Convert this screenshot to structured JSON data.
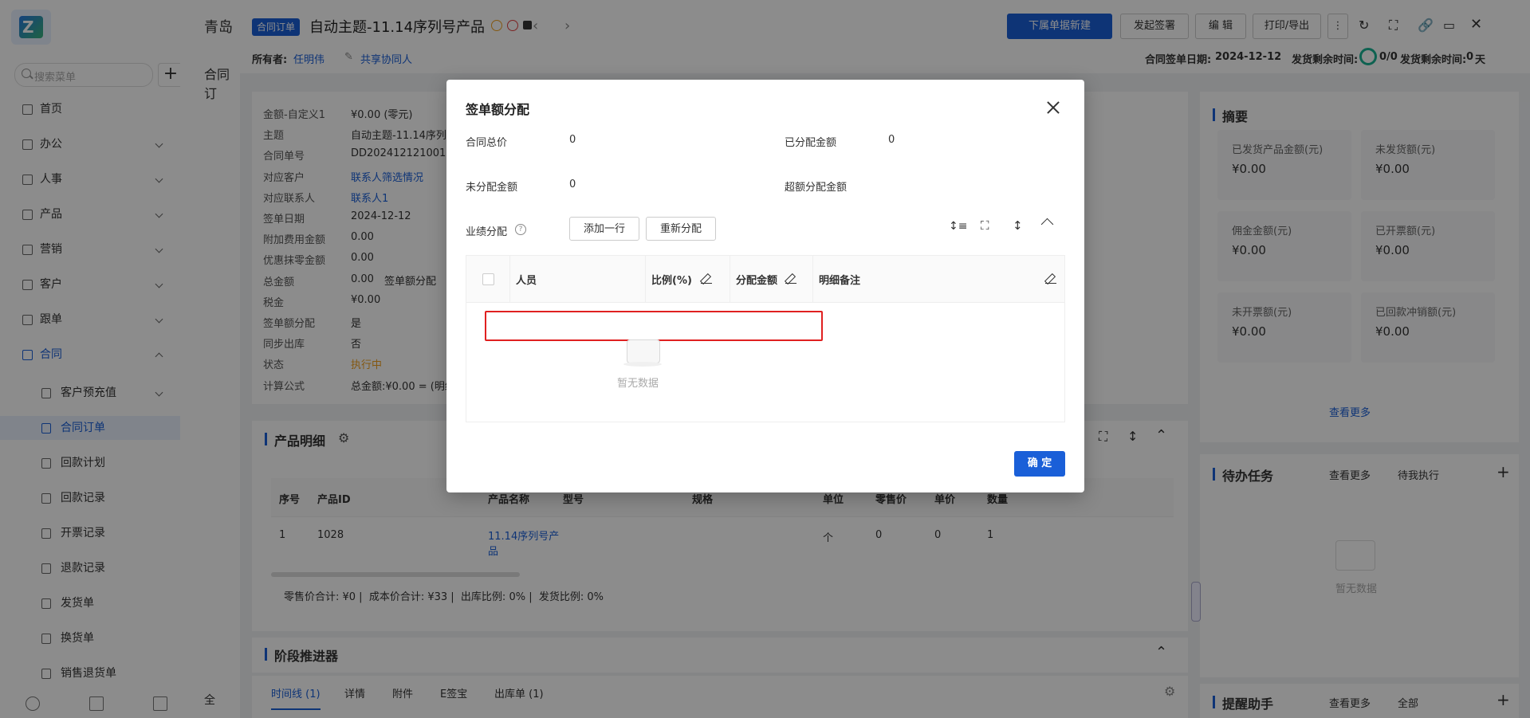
{
  "sidebar": {
    "search_placeholder": "搜索菜单",
    "add_label": "+",
    "items": [
      {
        "label": "首页",
        "icon": "home-icon"
      },
      {
        "label": "办公",
        "icon": "office-icon"
      },
      {
        "label": "人事",
        "icon": "people-icon"
      },
      {
        "label": "产品",
        "icon": "product-icon"
      },
      {
        "label": "营销",
        "icon": "marketing-icon"
      },
      {
        "label": "客户",
        "icon": "customer-icon"
      },
      {
        "label": "跟单",
        "icon": "followup-icon"
      },
      {
        "label": "合同",
        "icon": "contract-icon"
      }
    ],
    "sub_items": [
      {
        "label": "客户预充值"
      },
      {
        "label": "合同订单"
      },
      {
        "label": "回款计划"
      },
      {
        "label": "回款记录"
      },
      {
        "label": "开票记录"
      },
      {
        "label": "退款记录"
      },
      {
        "label": "发货单"
      },
      {
        "label": "换货单"
      },
      {
        "label": "销售退货单"
      }
    ]
  },
  "header": {
    "company_prefix": "青岛",
    "tag": "合同订单",
    "title": "自动主题-11.14序列号产品",
    "owner_label": "所有者:",
    "owner_name": "任明伟",
    "share_label": "共享协同人",
    "buttons": {
      "new_sub": "下属单据新建",
      "sign": "发起签署",
      "edit": "编 辑",
      "print": "打印/导出"
    },
    "sign_date_label": "合同签单日期:",
    "sign_date": "2024-12-12",
    "ship_remaining_label": "发货剩余时间:",
    "ship_ratio": "0/0",
    "ship_remaining_label2": "发货剩余时间:",
    "ship_days": "0",
    "ship_days_unit": "天"
  },
  "background_page": {
    "partial_tab": "合同订",
    "details": [
      {
        "k": "金额-自定义1",
        "v": "¥0.00 (零元)"
      },
      {
        "k": "主题",
        "v": "自动主题-11.14序列"
      },
      {
        "k": "合同单号",
        "v": "DD202412121001"
      },
      {
        "k": "对应客户",
        "v": "联系人筛选情况"
      },
      {
        "k": "对应联系人",
        "v": "联系人1"
      },
      {
        "k": "签单日期",
        "v": "2024-12-12"
      },
      {
        "k": "附加费用金额",
        "v": "0.00"
      },
      {
        "k": "优惠抹零金额",
        "v": "0.00"
      },
      {
        "k": "总金额",
        "v": "0.00"
      },
      {
        "k": "税金",
        "v": "¥0.00"
      },
      {
        "k": "签单额分配",
        "v": "是"
      },
      {
        "k": "同步出库",
        "v": "否"
      },
      {
        "k": "状态",
        "v": "执行中"
      },
      {
        "k": "计算公式",
        "v": "总金额:¥0.00 = (明细"
      }
    ],
    "total_side_label": "签单额分配",
    "product_section": "产品明细",
    "product_cols": [
      "序号",
      "产品ID",
      "产品名称",
      "型号",
      "规格",
      "单位",
      "零售价",
      "单价",
      "数量"
    ],
    "product_row": [
      "1",
      "1028",
      "11.14序列号产品",
      "",
      "",
      "个",
      "0",
      "0",
      "1"
    ],
    "product_summary": "零售价合计: ¥0 |  成本价合计: ¥33 |  出库比例: 0% |  发货比例: 0%",
    "stage_section": "阶段推进器",
    "tabs": [
      "时间线 (1)",
      "详情",
      "附件",
      "E签宝",
      "出库单 (1)"
    ],
    "summary_title": "摘要",
    "summary_cards": [
      {
        "k": "已发货产品金额(元)",
        "v": "¥0.00"
      },
      {
        "k": "未发货额(元)",
        "v": "¥0.00"
      },
      {
        "k": "佣金金额(元)",
        "v": "¥0.00"
      },
      {
        "k": "已开票额(元)",
        "v": "¥0.00"
      },
      {
        "k": "未开票额(元)",
        "v": "¥0.00"
      },
      {
        "k": "已回款冲销额(元)",
        "v": "¥0.00"
      }
    ],
    "see_more": "查看更多",
    "todo_title": "待办任务",
    "todo_filter": "待我执行",
    "empty": "暂无数据",
    "reminder_title": "提醒助手",
    "reminder_filter": "全部",
    "bottom_left": "全"
  },
  "modal": {
    "title": "签单额分配",
    "total_price_label": "合同总价",
    "total_price": "0",
    "allocated_label": "已分配金额",
    "allocated": "0",
    "unallocated_label": "未分配金额",
    "unallocated": "0",
    "over_label": "超额分配金额",
    "over": "",
    "perf_label": "业绩分配",
    "add_row": "添加一行",
    "reallocate": "重新分配",
    "columns": [
      "人员",
      "比例(%)",
      "分配金额",
      "明细备注"
    ],
    "empty": "暂无数据",
    "ok": "确 定"
  }
}
